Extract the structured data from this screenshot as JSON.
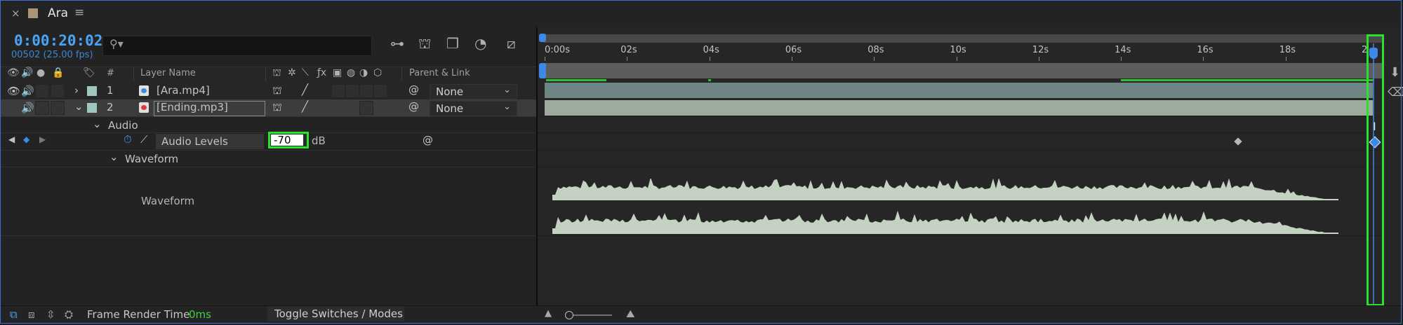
{
  "tab": {
    "close": "×",
    "title": "Ara",
    "menu": "≡",
    "color": "#a8957a"
  },
  "time": {
    "timecode": "0:00:20:02",
    "frame_rate": "00502 (25.00 fps)"
  },
  "search": {
    "placeholder": ""
  },
  "columns": {
    "number": "#",
    "layer_name": "Layer Name",
    "parent_link": "Parent & Link"
  },
  "layers": [
    {
      "number": "1",
      "name": "[Ara.mp4]",
      "parent": "None",
      "label_color": "#9fc6c0"
    },
    {
      "number": "2",
      "name": "[Ending.mp3]",
      "parent": "None",
      "label_color": "#9fc6c0"
    }
  ],
  "properties": {
    "audio_group": "Audio",
    "audio_levels": "Audio Levels",
    "audio_levels_value": "-70",
    "audio_levels_unit": "dB",
    "waveform_group": "Waveform",
    "waveform_label": "Waveform"
  },
  "ruler": {
    "ticks": [
      "0:00s",
      "02s",
      "04s",
      "06s",
      "08s",
      "10s",
      "12s",
      "14s",
      "16s",
      "18s",
      "2"
    ]
  },
  "bottom": {
    "frame_render_time_label": "Frame Render Time",
    "frame_render_time_value": "0ms",
    "toggle_label": "Toggle Switches / Modes"
  },
  "colors": {
    "accent": "#3d8ae6",
    "highlight": "#28e32b",
    "waveform": "#c4d3c1"
  }
}
